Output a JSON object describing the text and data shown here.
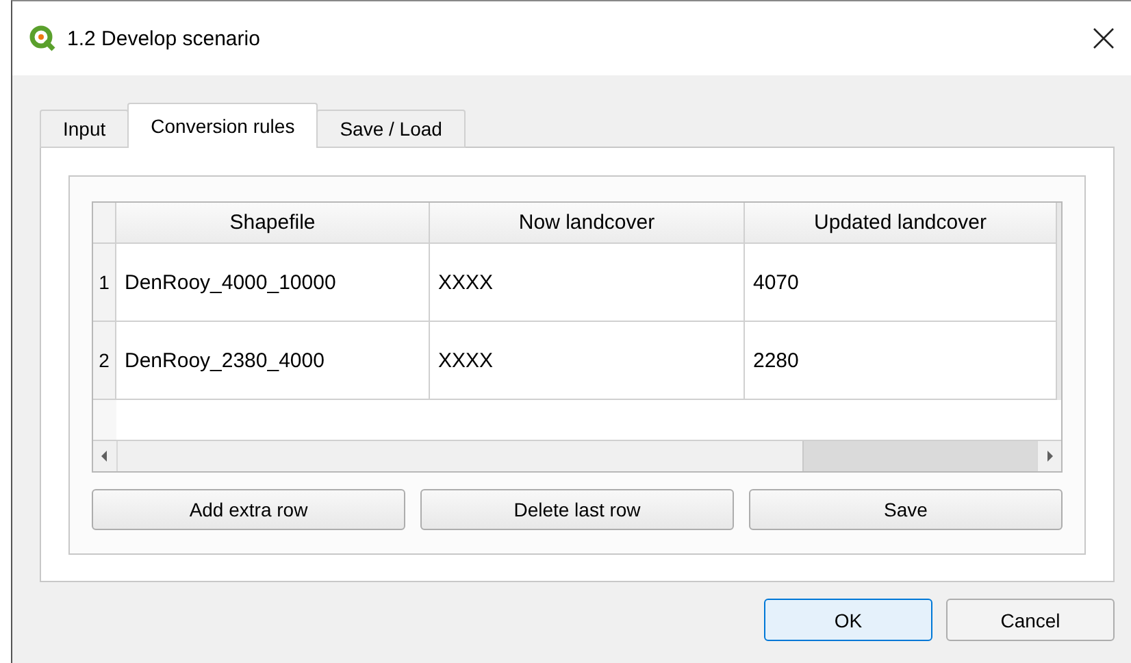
{
  "window": {
    "title": "1.2 Develop scenario"
  },
  "tabs": [
    {
      "label": "Input",
      "selected": false
    },
    {
      "label": "Conversion rules",
      "selected": true
    },
    {
      "label": "Save / Load",
      "selected": false
    }
  ],
  "table": {
    "columns": [
      "Shapefile",
      "Now landcover",
      "Updated landcover"
    ],
    "rows": [
      {
        "number": "1",
        "cells": [
          "DenRooy_4000_10000",
          "XXXX",
          "4070"
        ]
      },
      {
        "number": "2",
        "cells": [
          "DenRooy_2380_4000",
          "XXXX",
          "2280"
        ]
      }
    ]
  },
  "actions": [
    "Add extra row",
    "Delete last row",
    "Save"
  ],
  "buttons": [
    {
      "label": "OK",
      "default": true
    },
    {
      "label": "Cancel",
      "default": false
    }
  ]
}
